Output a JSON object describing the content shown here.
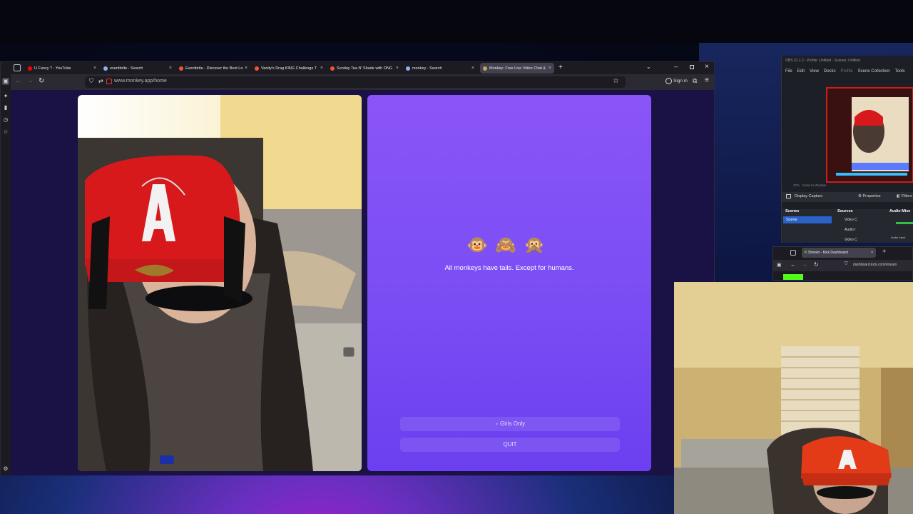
{
  "colors": {
    "accent": "#7a4df4",
    "tab_active": "#42414d",
    "obs_red": "#d01b1b",
    "kick_green": "#53fc18"
  },
  "browser": {
    "tabs": [
      {
        "label": "U Fancy ? - YouTube",
        "icon": "youtube-icon",
        "color": "#ff0000",
        "active": false
      },
      {
        "label": "eventbrite - Search",
        "icon": "search-icon",
        "color": "#8ab4f8",
        "active": false
      },
      {
        "label": "Eventbrite - Discover the Best Lo",
        "icon": "eventbrite-icon",
        "color": "#f05537",
        "active": false
      },
      {
        "label": "Vanity's Drag KING Challenge T",
        "icon": "eventbrite-icon",
        "color": "#f05537",
        "active": false
      },
      {
        "label": "Sunday Tea N' Shade with ONG",
        "icon": "eventbrite-icon",
        "color": "#f05537",
        "active": false
      },
      {
        "label": "monkey - Search",
        "icon": "search-icon",
        "color": "#8ab4f8",
        "active": false
      },
      {
        "label": "Monkey: Free Live Video Chat &",
        "icon": "monkey-icon",
        "color": "#c8a063",
        "active": true
      }
    ],
    "url": "www.monkey.app/home",
    "sign_in": "Sign in"
  },
  "monkey": {
    "emojis": "🐵🙈🙊",
    "tagline": "All monkeys have tails. Except for humans.",
    "girls_only": "Girls Only",
    "quit": "QUIT"
  },
  "obs": {
    "title": "OBS 31.1.2 - Profile: Untitled - Scenes: Untitled",
    "menu": [
      "File",
      "Edit",
      "View",
      "Docks",
      "Profile",
      "Scene Collection",
      "Tools"
    ],
    "zoom": "37%",
    "scale": "Scale to Window",
    "source_name": "Display Capture",
    "properties": "Properties",
    "filters": "Filters",
    "scenes_header": "Scenes",
    "scene_item": "Scene",
    "sources_header": "Sources",
    "sources": [
      "Video C",
      "Audio I",
      "Video C"
    ],
    "audio_header": "Audio Mixe",
    "audio_input": "Audio Input"
  },
  "kick": {
    "tab_label": "Stream - Kick Dashboard",
    "url": "dashboard.kick.com/stream"
  }
}
